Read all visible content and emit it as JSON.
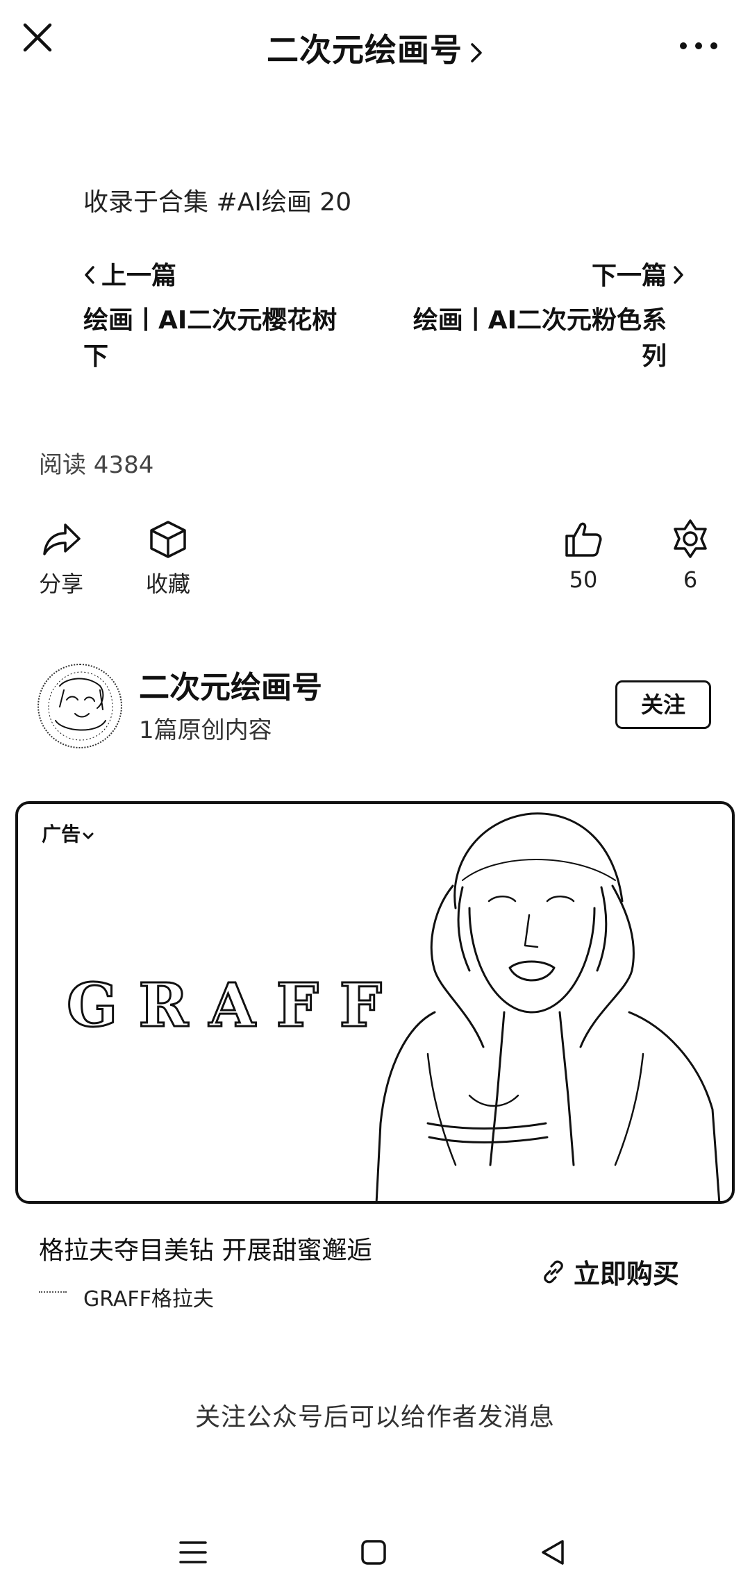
{
  "header": {
    "close_icon": "close-icon",
    "title": "二次元绘画号",
    "more_icon": "more-icon"
  },
  "collection": {
    "text": "收录于合集 #AI绘画 20"
  },
  "prev": {
    "label": "上一篇",
    "title": "绘画丨AI二次元樱花树下"
  },
  "next": {
    "label": "下一篇",
    "title": "绘画丨AI二次元粉色系列"
  },
  "reads": {
    "text": "阅读 4384"
  },
  "actions": {
    "share": {
      "label": "分享",
      "icon": "share-icon"
    },
    "favorite": {
      "label": "收藏",
      "icon": "cube-icon"
    },
    "like": {
      "count": "50",
      "icon": "thumb-up-icon"
    },
    "wow": {
      "count": "6",
      "icon": "star-flower-icon"
    }
  },
  "author": {
    "name": "二次元绘画号",
    "subtitle": "1篇原创内容",
    "follow_label": "关注"
  },
  "ad": {
    "badge": "广告",
    "brand": "GRAFF",
    "headline": "格拉夫夺目美钻 开展甜蜜邂逅",
    "source": "GRAFF格拉夫",
    "cta": "立即购买"
  },
  "footer": {
    "message": "关注公众号后可以给作者发消息"
  },
  "system_nav": {
    "menu_icon": "menu-icon",
    "home_icon": "home-square-icon",
    "back_icon": "back-triangle-icon"
  },
  "colors": {
    "ink": "#111111",
    "background": "#ffffff"
  }
}
